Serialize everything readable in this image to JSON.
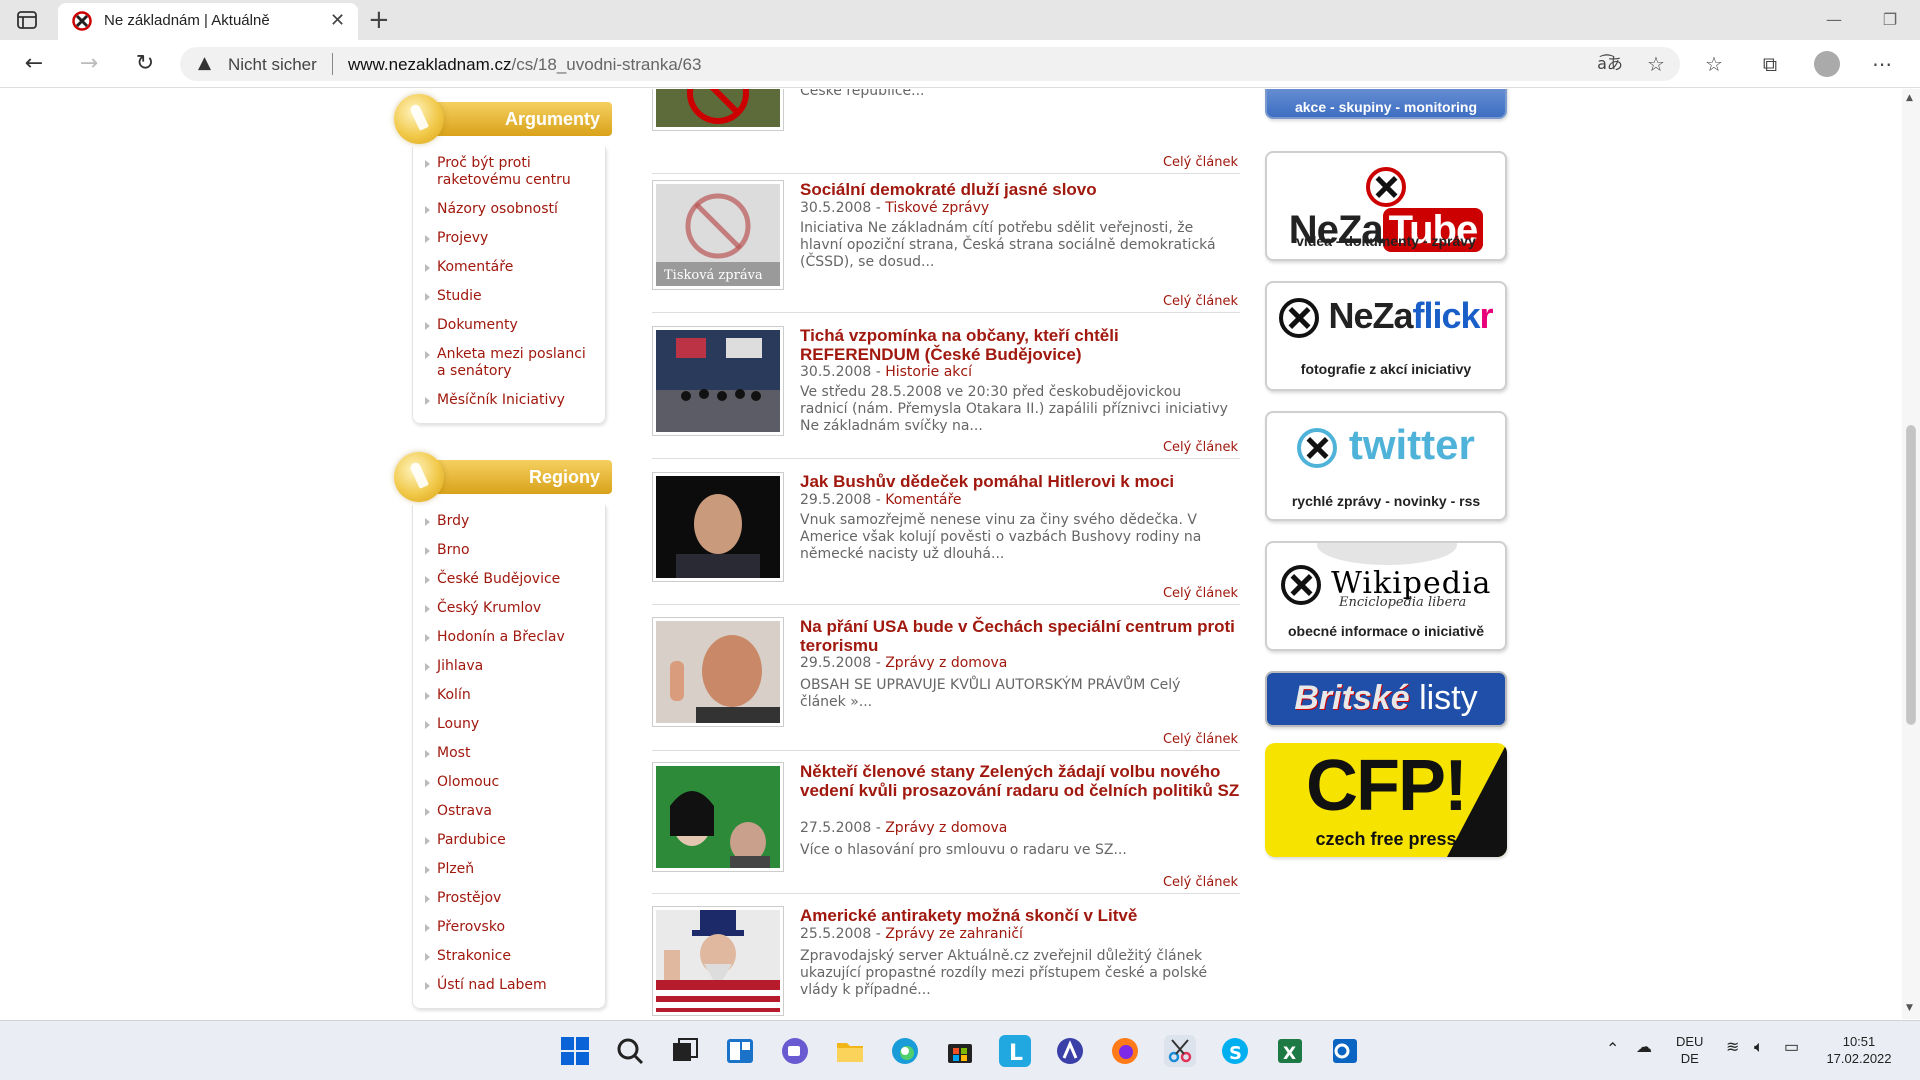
{
  "browser": {
    "tab_title": "Ne základnám | Aktuálně",
    "security_label": "Nicht sicher",
    "url_host": "www.nezakladnam.cz",
    "url_path": "/cs/18_uvodni-stranka/63"
  },
  "sidebar": {
    "argumenty": {
      "title": "Argumenty",
      "items": [
        {
          "label": "Proč být proti raketovému centru"
        },
        {
          "label": "Názory osobností"
        },
        {
          "label": "Projevy"
        },
        {
          "label": "Komentáře"
        },
        {
          "label": "Studie"
        },
        {
          "label": "Dokumenty"
        },
        {
          "label": "Anketa mezi poslanci a senátory"
        },
        {
          "label": "Měsíčník Iniciativy"
        }
      ]
    },
    "regiony": {
      "title": "Regiony",
      "items": [
        {
          "label": "Brdy"
        },
        {
          "label": "Brno"
        },
        {
          "label": "České Budějovice"
        },
        {
          "label": "Český Krumlov"
        },
        {
          "label": "Hodonín a Břeclav"
        },
        {
          "label": "Jihlava"
        },
        {
          "label": "Kolín"
        },
        {
          "label": "Louny"
        },
        {
          "label": "Most"
        },
        {
          "label": "Olomouc"
        },
        {
          "label": "Ostrava"
        },
        {
          "label": "Pardubice"
        },
        {
          "label": "Plzeň"
        },
        {
          "label": "Prostějov"
        },
        {
          "label": "Přerovsko"
        },
        {
          "label": "Strakonice"
        },
        {
          "label": "Ústí nad Labem"
        }
      ]
    }
  },
  "articles": {
    "more_label": "Celý článek",
    "top_partial_text": "Agentura STEM zveřejnila projekt Kontakt.... veřejného mínění v otázce případného umístění amerického radaru v České republice...",
    "items": [
      {
        "title": "Sociální demokraté dluží jasné slovo",
        "date": "30.5.2008",
        "category": "Tiskové zprávy",
        "text": "Iniciativa Ne základnám cítí potřebu sdělit veřejnosti, že hlavní opoziční strana, Česká strana sociálně demokratická (ČSSD), se dosud...",
        "thumb_caption": "Tisková zpráva"
      },
      {
        "title": "Tichá vzpomínka na občany, kteří chtěli REFERENDUM (České Budějovice)",
        "date": "30.5.2008",
        "category": "Historie akcí",
        "text": "Ve středu 28.5.2008 ve 20:30 před českobudějovickou radnicí (nám. Přemysla Otakara II.) zapálili příznivci iniciativy Ne základnám svíčky na..."
      },
      {
        "title": "Jak Bushův dědeček pomáhal Hitlerovi k moci",
        "date": "29.5.2008",
        "category": "Komentáře",
        "text": "Vnuk samozřejmě nenese vinu za činy svého dědečka. V Americe však kolují pověsti o vazbách Bushovy rodiny na německé nacisty už dlouhá..."
      },
      {
        "title": "Na přání USA bude v Čechách speciální centrum proti terorismu",
        "date": "29.5.2008",
        "category": "Zprávy z domova",
        "text": "OBSAH SE UPRAVUJE KVŮLI AUTORSKÝM PRÁVŮM Celý článek »..."
      },
      {
        "title": "Někteří členové stany Zelených žádají volbu nového vedení kvůli prosazování radaru od čelních politiků SZ",
        "date": "27.5.2008",
        "category": "Zprávy z domova",
        "text": "Více o hlasování  pro smlouvu o radaru ve SZ..."
      },
      {
        "title": "Americké antirakety možná skončí v Litvě",
        "date": "25.5.2008",
        "category": "Zprávy ze zahraničí",
        "text": "Zpravodajský server Aktuálně.cz zveřejnil důležitý článek ukazující propastné rozdíly mezi přístupem české a polské vlády k případné..."
      }
    ]
  },
  "banners": {
    "akce": "akce - skupiny - monitoring",
    "tube": {
      "brand_a": "NeZa",
      "brand_b": "Tube",
      "sub": "videa - dokumenty - zprávy"
    },
    "flickr": {
      "brand_a": "NeZa",
      "brand_b": "flick",
      "brand_c": "r",
      "sub": "fotografie z akcí iniciativy"
    },
    "twitter": {
      "brand": "twitter",
      "sub": "rychlé zprávy - novinky - rss"
    },
    "wikipedia": {
      "brand": "Wikipedia",
      "tag": "Enciclopedia libera",
      "sub": "obecné informace o iniciativě"
    },
    "britske": {
      "brand_a": "Britské",
      "brand_b": "listy"
    },
    "cfp": {
      "brand": "CFP!",
      "sub": "czech free press"
    }
  },
  "taskbar": {
    "lang_top": "DEU",
    "lang_bottom": "DE",
    "time": "10:51",
    "date": "17.02.2022"
  },
  "colors": {
    "accent_red": "#a0180e",
    "gold": "#e0ac22",
    "twitter_blue": "#4fb3d9",
    "cfp_yellow": "#f7e300"
  }
}
